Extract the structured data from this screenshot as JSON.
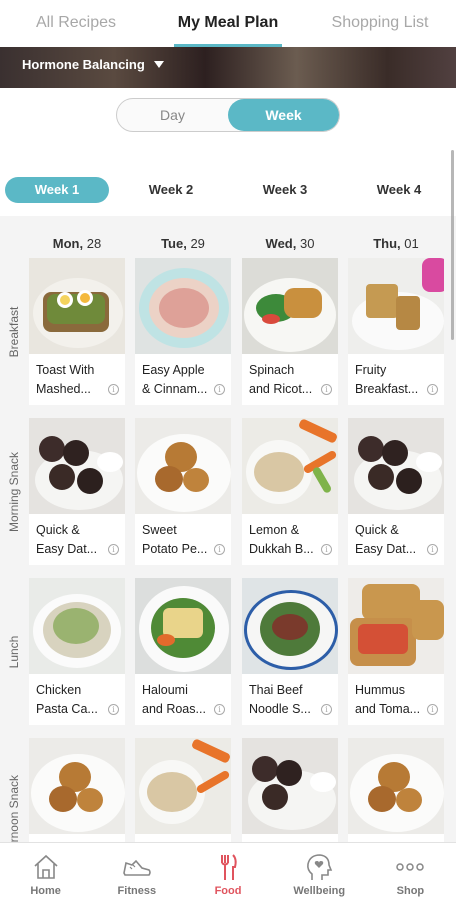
{
  "top_tabs": [
    {
      "label": "All Recipes"
    },
    {
      "label": "My Meal Plan"
    },
    {
      "label": "Shopping List"
    }
  ],
  "plan_selector": {
    "label": "Hormone Balancing"
  },
  "view_toggle": {
    "day": "Day",
    "week": "Week",
    "selected": "Week"
  },
  "week_tabs": [
    {
      "label": "Week 1"
    },
    {
      "label": "Week 2"
    },
    {
      "label": "Week 3"
    },
    {
      "label": "Week 4"
    }
  ],
  "days": [
    {
      "name": "Mon,",
      "date": "28"
    },
    {
      "name": "Tue,",
      "date": "29"
    },
    {
      "name": "Wed,",
      "date": "30"
    },
    {
      "name": "Thu,",
      "date": "01"
    }
  ],
  "meals": [
    {
      "label": "Breakfast",
      "items": [
        "Toast With\nMashed...",
        "Easy Apple\n& Cinnam...",
        "Spinach\nand Ricot...",
        "Fruity\nBreakfast..."
      ]
    },
    {
      "label": "Morning Snack",
      "items": [
        "Quick &\nEasy Dat...",
        "Sweet\nPotato Pe...",
        "Lemon &\nDukkah B...",
        "Quick &\nEasy Dat..."
      ]
    },
    {
      "label": "Lunch",
      "items": [
        "Chicken\nPasta Ca...",
        "Haloumi\nand Roas...",
        "Thai Beef\nNoodle S...",
        "Hummus\nand Toma..."
      ]
    },
    {
      "label": "ernoon Snack",
      "items": [
        "",
        "",
        "",
        ""
      ]
    }
  ],
  "bottom_nav": [
    {
      "label": "Home",
      "icon": "home-icon"
    },
    {
      "label": "Fitness",
      "icon": "shoe-icon"
    },
    {
      "label": "Food",
      "icon": "fork-knife-icon"
    },
    {
      "label": "Wellbeing",
      "icon": "head-heart-icon"
    },
    {
      "label": "Shop",
      "icon": "more-dots-icon"
    }
  ],
  "colors": {
    "accent": "#5bb8c6",
    "food_active": "#e0545e",
    "inactive": "#777777"
  }
}
